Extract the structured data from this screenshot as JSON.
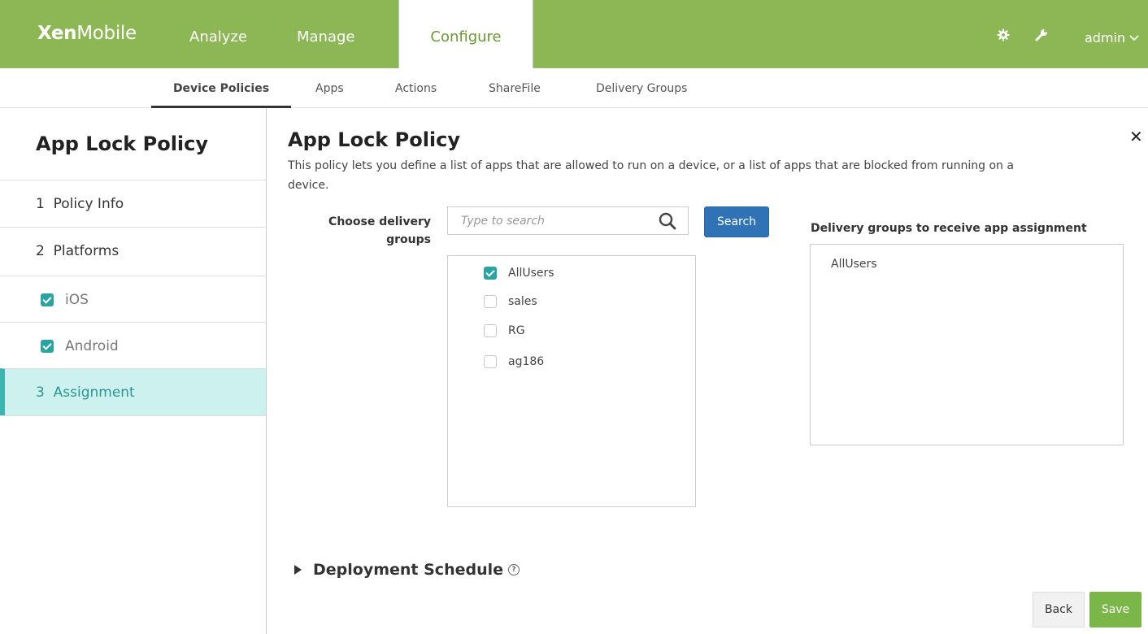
{
  "app": {
    "logo_bold": "Xen",
    "logo_rest": "Mobile"
  },
  "topnav": {
    "analyze": "Analyze",
    "manage": "Manage",
    "configure": "Configure",
    "user": "admin",
    "icons": [
      "gear-icon",
      "wrench-icon",
      "chevron-down-icon"
    ]
  },
  "subnav": {
    "device_policies": "Device Policies",
    "apps": "Apps",
    "actions": "Actions",
    "sharefile": "ShareFile",
    "delivery_groups": "Delivery Groups",
    "active": "Device Policies"
  },
  "sidebar": {
    "title": "App Lock Policy",
    "steps": [
      {
        "label": "1  Policy Info"
      },
      {
        "label": "2  Platforms"
      },
      {
        "label": "iOS",
        "checked": true
      },
      {
        "label": "Android",
        "checked": true
      },
      {
        "label": "3  Assignment",
        "active": true
      }
    ]
  },
  "main": {
    "title": "App Lock Policy",
    "description": "This policy lets you define a list of apps that are allowed to run on a device, or a list of apps that are blocked from running on a device.",
    "choose_label": "Choose delivery groups",
    "search_placeholder": "Type to search",
    "search_button": "Search",
    "groups": [
      {
        "name": "AllUsers",
        "checked": true
      },
      {
        "name": "sales",
        "checked": false
      },
      {
        "name": "RG",
        "checked": false
      },
      {
        "name": "ag186",
        "checked": false
      }
    ],
    "receive_label": "Delivery groups to receive app assignment",
    "receive_items": [
      "AllUsers"
    ],
    "deployment_schedule": "Deployment Schedule",
    "back_button": "Back",
    "save_button": "Save"
  },
  "colors": {
    "topbar": "#8db755",
    "configure_text": "#6a9a32",
    "active_step_bg": "#cdf1ef",
    "active_step_text": "#2d9595",
    "checkbox": "#2aa3a3",
    "search_button": "#2f73b6",
    "save_button": "#7ab648"
  }
}
